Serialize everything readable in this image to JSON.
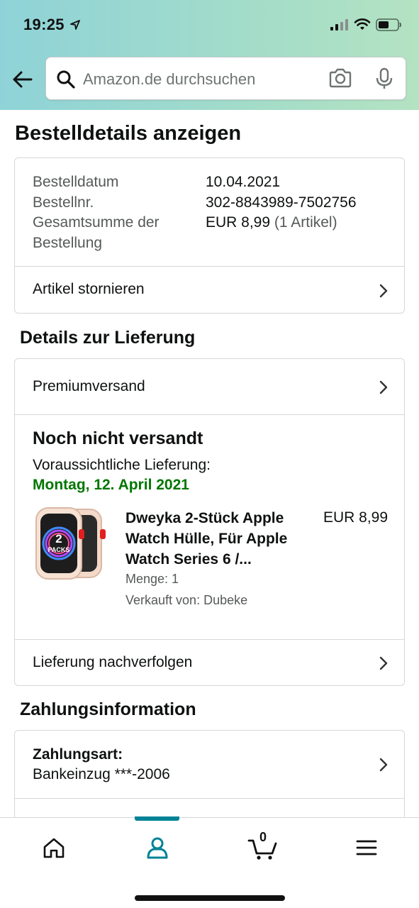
{
  "status_bar": {
    "time": "19:25"
  },
  "search": {
    "placeholder": "Amazon.de durchsuchen"
  },
  "page_title": "Bestelldetails anzeigen",
  "order_summary": {
    "rows": [
      {
        "label": "Bestelldatum",
        "value": "10.04.2021"
      },
      {
        "label": "Bestellnr.",
        "value": "302-8843989-7502756"
      },
      {
        "label": "Gesamtsumme der Bestellung",
        "value": "EUR 8,99",
        "value_extra": "(1 Artikel)"
      }
    ],
    "cancel_label": "Artikel stornieren"
  },
  "delivery": {
    "section_title": "Details zur Lieferung",
    "shipping_method": "Premiumversand",
    "status": "Noch nicht versandt",
    "eta_label": "Voraussichtliche Lieferung:",
    "eta_date": "Montag, 12. April 2021",
    "product": {
      "image_text": "2 PACKS",
      "title": "Dweyka 2-Stück Apple Watch Hülle, Für Apple Watch Series 6 /...",
      "price": "EUR 8,99",
      "quantity": "Menge: 1",
      "seller": "Verkauft von: Dubeke"
    },
    "track_label": "Lieferung nachverfolgen"
  },
  "payment": {
    "section_title": "Zahlungsinformation",
    "method_label": "Zahlungsart:",
    "method_value": "Bankeinzug ***-2006"
  },
  "bottom_nav": {
    "items": [
      "home",
      "account",
      "cart",
      "menu"
    ],
    "active": "account",
    "cart_count": "0"
  },
  "colors": {
    "accent": "#008296",
    "delivery_date": "#007600",
    "header_gradient_start": "#8fd3d8",
    "header_gradient_end": "#b4e3c2"
  }
}
